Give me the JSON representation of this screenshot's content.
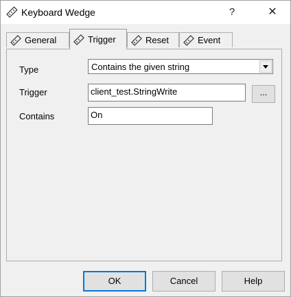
{
  "window": {
    "title": "Keyboard Wedge",
    "help_glyph": "?",
    "close_glyph": "✕"
  },
  "tabs": [
    {
      "label": "General",
      "icon": "ruler-pencil-icon",
      "active": false
    },
    {
      "label": "Trigger",
      "icon": "ruler-pencil-icon",
      "active": true
    },
    {
      "label": "Reset",
      "icon": "ruler-pencil-icon",
      "active": false
    },
    {
      "label": "Event",
      "icon": "ruler-pencil-icon",
      "active": false
    }
  ],
  "form": {
    "type_label": "Type",
    "type_value": "Contains the given string",
    "trigger_label": "Trigger",
    "trigger_value": "client_test.StringWrite",
    "browse_label": "...",
    "contains_label": "Contains",
    "contains_value": "On"
  },
  "buttons": {
    "ok": "OK",
    "cancel": "Cancel",
    "help": "Help"
  }
}
